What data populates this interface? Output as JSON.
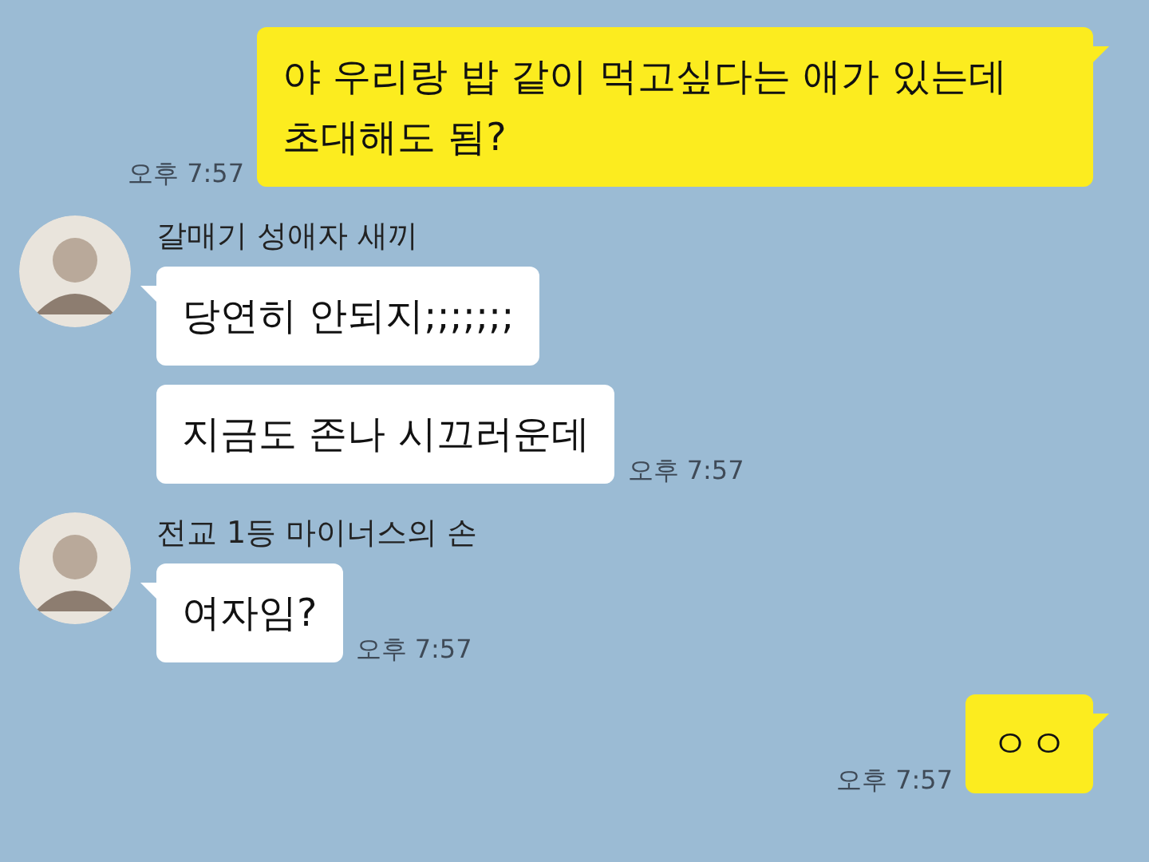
{
  "messages": [
    {
      "kind": "sent",
      "bubbles": [
        "야 우리랑 밥 같이 먹고싶다는 애가 있는데 초대해도 됨?"
      ],
      "time": "오후 7:57"
    },
    {
      "kind": "received",
      "sender": "갈매기 성애자 새끼",
      "bubbles": [
        "당연히 안되지;;;;;;;",
        "지금도 존나 시끄러운데"
      ],
      "time": "오후 7:57"
    },
    {
      "kind": "received",
      "sender": "전교 1등 마이너스의 손",
      "bubbles": [
        "여자임?"
      ],
      "time": "오후 7:57"
    },
    {
      "kind": "sent",
      "bubbles": [
        "ㅇㅇ"
      ],
      "time": "오후 7:57"
    }
  ]
}
